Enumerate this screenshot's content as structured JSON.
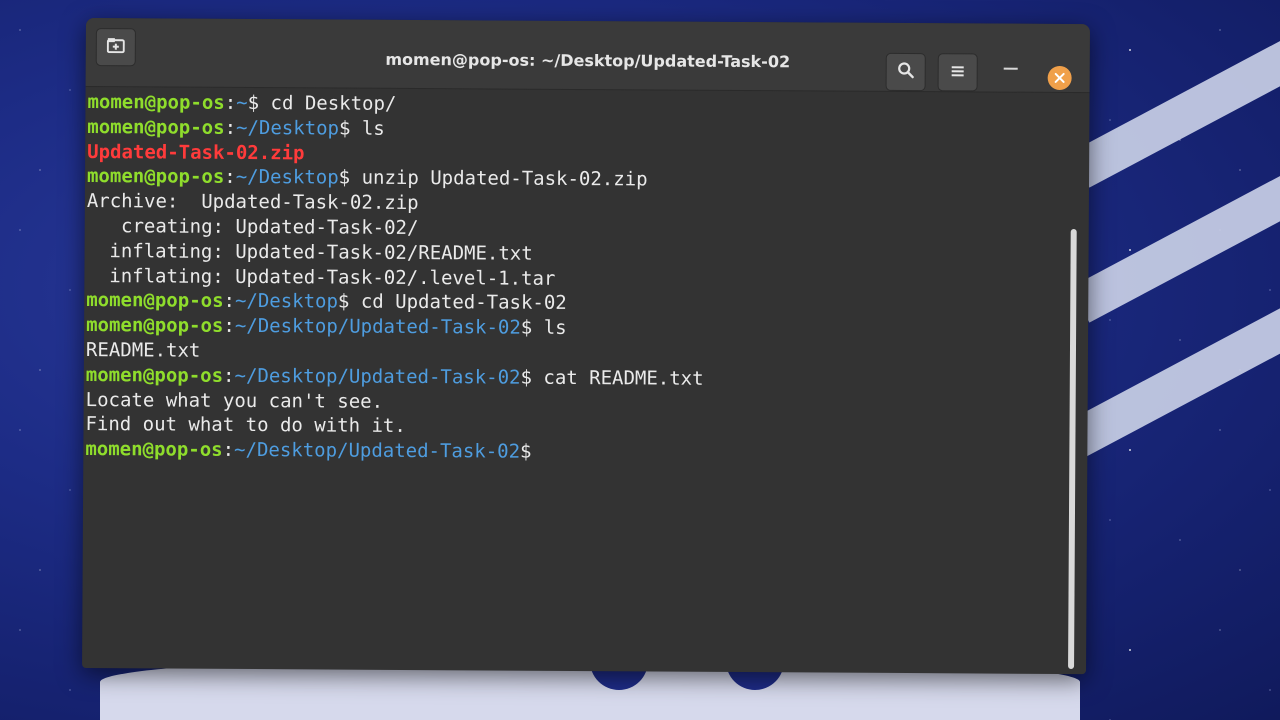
{
  "window": {
    "title": "momen@pop-os: ~/Desktop/Updated-Task-02",
    "icons": {
      "new_tab": "new-tab-icon",
      "search": "search-icon",
      "menu": "hamburger-menu-icon",
      "minimize": "minimize-icon",
      "close": "close-icon"
    },
    "colors": {
      "user": "#8fdd2c",
      "path": "#4e9de0",
      "archive_file": "#ff3b3b",
      "text": "#eaeaea",
      "close_button": "#f0a04a",
      "background": "#333333"
    }
  },
  "terminal": {
    "prompt_user": "momen@pop-os",
    "colon": ":",
    "dollar": "$",
    "lines": [
      {
        "type": "prompt",
        "path": "~",
        "command": " cd Desktop/"
      },
      {
        "type": "prompt",
        "path": "~/Desktop",
        "command": " ls"
      },
      {
        "type": "zip",
        "text": "Updated-Task-02.zip"
      },
      {
        "type": "prompt",
        "path": "~/Desktop",
        "command": " unzip Updated-Task-02.zip"
      },
      {
        "type": "output",
        "text": "Archive:  Updated-Task-02.zip"
      },
      {
        "type": "output",
        "text": "   creating: Updated-Task-02/"
      },
      {
        "type": "output",
        "text": "  inflating: Updated-Task-02/README.txt"
      },
      {
        "type": "output",
        "text": "  inflating: Updated-Task-02/.level-1.tar"
      },
      {
        "type": "prompt",
        "path": "~/Desktop",
        "command": " cd Updated-Task-02"
      },
      {
        "type": "prompt",
        "path": "~/Desktop/Updated-Task-02",
        "command": " ls"
      },
      {
        "type": "output",
        "text": "README.txt"
      },
      {
        "type": "prompt",
        "path": "~/Desktop/Updated-Task-02",
        "command": " cat README.txt"
      },
      {
        "type": "output",
        "text": "Locate what you can't see."
      },
      {
        "type": "output",
        "text": "Find out what to do with it."
      },
      {
        "type": "prompt",
        "path": "~/Desktop/Updated-Task-02",
        "command": ""
      }
    ]
  }
}
